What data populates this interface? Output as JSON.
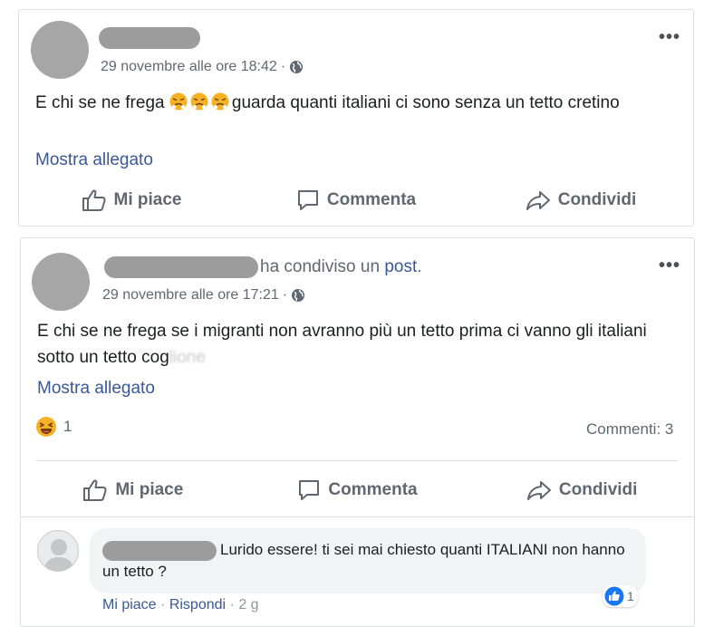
{
  "post1": {
    "timestamp": "29 novembre alle ore 18:42",
    "separator": "·",
    "text_before": "E chi se ne frega ",
    "text_after": "guarda quanti italiani ci sono senza un tetto cretino",
    "emoji_icon": "huffing-face-emoji",
    "attachment_link": "Mostra allegato",
    "more_icon": "•••",
    "actions": {
      "like": "Mi piace",
      "comment": "Commenta",
      "share": "Condividi"
    }
  },
  "post2": {
    "shared_label": "ha condiviso un",
    "shared_link": "post",
    "shared_period": ".",
    "timestamp": "29 novembre alle ore 17:21",
    "separator": "·",
    "text": "E chi se ne frega se i migranti non avranno più un tetto prima ci vanno gli italiani sotto un tetto cog",
    "text_blurred": "lione",
    "attachment_link": "Mostra allegato",
    "more_icon": "•••",
    "reaction_icon": "laughing-emoji",
    "reaction_count": "1",
    "comments_count": "Commenti: 3",
    "actions": {
      "like": "Mi piace",
      "comment": "Commenta",
      "share": "Condividi"
    }
  },
  "comment": {
    "text": "Lurido essere! ti sei mai chiesto quanti ITALIANI non hanno un tetto ?",
    "like_link": "Mi piace",
    "reply_link": "Rispondi",
    "dot": "·",
    "age": "2 g",
    "like_count": "1"
  },
  "colors": {
    "link": "#385898",
    "meta": "#606770",
    "like_blue": "#1877f2",
    "redaction": "#9c9c9c"
  }
}
